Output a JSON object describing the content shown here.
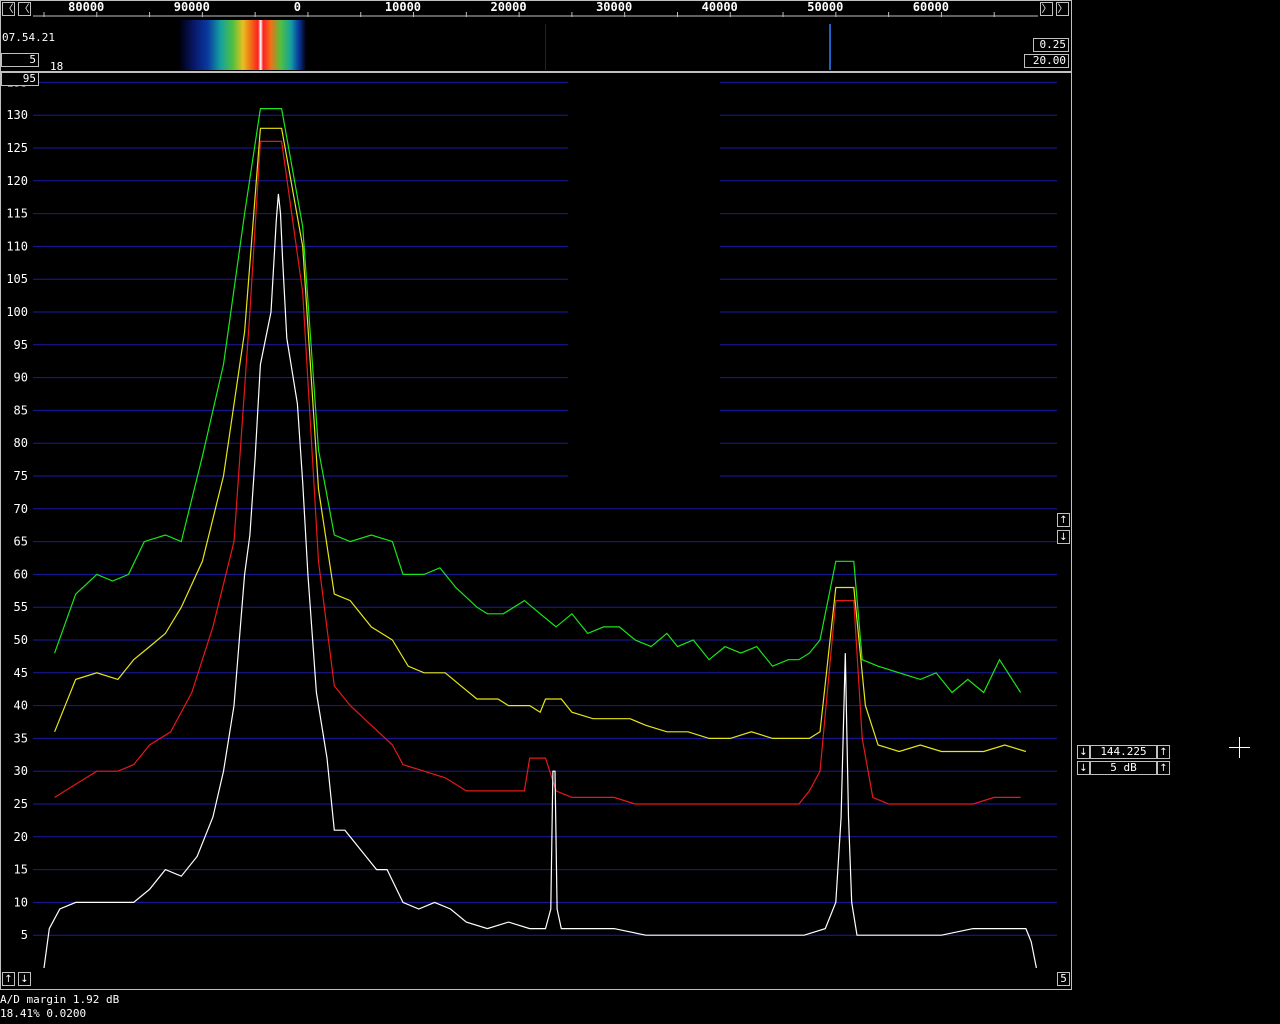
{
  "top_panel": {
    "time": "07.54.21",
    "left_value": "5",
    "left_small": "18",
    "right_value_1": "0.25",
    "right_value_2": "20.00",
    "freq_ticks": [
      {
        "label": "80000",
        "hz": -20000
      },
      {
        "label": "90000",
        "hz": -10000
      },
      {
        "label": "0",
        "hz": 0
      },
      {
        "label": "10000",
        "hz": 10000
      },
      {
        "label": "20000",
        "hz": 20000
      },
      {
        "label": "30000",
        "hz": 30000
      },
      {
        "label": "40000",
        "hz": 40000
      },
      {
        "label": "50000",
        "hz": 50000
      },
      {
        "label": "60000",
        "hz": 60000
      }
    ],
    "scroll_left_icon": "arrow-left-icon",
    "scroll_right_icon": "arrow-right-icon"
  },
  "main": {
    "ref_box": "95",
    "bottom_box": "5"
  },
  "right_panel": {
    "freq_value": "144.225",
    "step_value": "5 dB"
  },
  "status": {
    "line1": "A/D margin  1.92 dB",
    "line2": "18.41% 0.0200"
  },
  "chart_data": {
    "type": "line",
    "x_unit": "Hz offset",
    "xlim": [
      -24000,
      71000
    ],
    "ylim": [
      0,
      138
    ],
    "yticks": [
      5,
      10,
      15,
      20,
      25,
      30,
      35,
      40,
      45,
      50,
      55,
      60,
      65,
      70,
      75,
      80,
      85,
      90,
      95,
      100,
      105,
      110,
      115,
      120,
      125,
      130,
      135
    ],
    "grid": true,
    "colors": {
      "grid": "#1a1aa8",
      "green": "#19e619",
      "yellow": "#e6e619",
      "red": "#e61919",
      "white": "#ffffff"
    },
    "series": [
      {
        "color": "green",
        "points": [
          [
            -23000,
            48
          ],
          [
            -21000,
            57
          ],
          [
            -19000,
            60
          ],
          [
            -17500,
            59
          ],
          [
            -16000,
            60
          ],
          [
            -14500,
            65
          ],
          [
            -12500,
            66
          ],
          [
            -11000,
            65
          ],
          [
            -9000,
            78
          ],
          [
            -7000,
            92
          ],
          [
            -5000,
            115
          ],
          [
            -3500,
            131
          ],
          [
            -1500,
            131
          ],
          [
            500,
            113
          ],
          [
            2000,
            79
          ],
          [
            3500,
            66
          ],
          [
            5000,
            65
          ],
          [
            7000,
            66
          ],
          [
            9000,
            65
          ],
          [
            10000,
            60
          ],
          [
            12000,
            60
          ],
          [
            13500,
            61
          ],
          [
            15000,
            58
          ],
          [
            17000,
            55
          ],
          [
            18000,
            54
          ],
          [
            19500,
            54
          ],
          [
            21500,
            56
          ],
          [
            23000,
            54
          ],
          [
            24500,
            52
          ],
          [
            26000,
            54
          ],
          [
            27500,
            51
          ],
          [
            29000,
            52
          ],
          [
            30500,
            52
          ],
          [
            32000,
            50
          ],
          [
            33500,
            49
          ],
          [
            35000,
            51
          ],
          [
            36000,
            49
          ],
          [
            37500,
            50
          ],
          [
            39000,
            47
          ],
          [
            40500,
            49
          ],
          [
            42000,
            48
          ],
          [
            43500,
            49
          ],
          [
            45000,
            46
          ],
          [
            46500,
            47
          ],
          [
            47500,
            47
          ],
          [
            48500,
            48
          ],
          [
            49500,
            50
          ],
          [
            51000,
            62
          ],
          [
            52700,
            62
          ],
          [
            53500,
            47
          ],
          [
            55000,
            46
          ],
          [
            57000,
            45
          ],
          [
            59000,
            44
          ],
          [
            60500,
            45
          ],
          [
            62000,
            42
          ],
          [
            63500,
            44
          ],
          [
            65000,
            42
          ],
          [
            66500,
            47
          ],
          [
            68500,
            42
          ]
        ]
      },
      {
        "color": "yellow",
        "points": [
          [
            -23000,
            36
          ],
          [
            -21000,
            44
          ],
          [
            -19000,
            45
          ],
          [
            -17000,
            44
          ],
          [
            -15500,
            47
          ],
          [
            -14000,
            49
          ],
          [
            -12500,
            51
          ],
          [
            -11000,
            55
          ],
          [
            -9000,
            62
          ],
          [
            -7000,
            75
          ],
          [
            -5000,
            97
          ],
          [
            -3500,
            128
          ],
          [
            -1500,
            128
          ],
          [
            500,
            110
          ],
          [
            2000,
            73
          ],
          [
            3500,
            57
          ],
          [
            5000,
            56
          ],
          [
            7000,
            52
          ],
          [
            9000,
            50
          ],
          [
            10500,
            46
          ],
          [
            12000,
            45
          ],
          [
            14000,
            45
          ],
          [
            15500,
            43
          ],
          [
            17000,
            41
          ],
          [
            19000,
            41
          ],
          [
            20000,
            40
          ],
          [
            22000,
            40
          ],
          [
            23000,
            39
          ],
          [
            23500,
            41
          ],
          [
            25000,
            41
          ],
          [
            26000,
            39
          ],
          [
            28000,
            38
          ],
          [
            30000,
            38
          ],
          [
            31500,
            38
          ],
          [
            33000,
            37
          ],
          [
            35000,
            36
          ],
          [
            37000,
            36
          ],
          [
            39000,
            35
          ],
          [
            41000,
            35
          ],
          [
            43000,
            36
          ],
          [
            45000,
            35
          ],
          [
            47000,
            35
          ],
          [
            48500,
            35
          ],
          [
            49500,
            36
          ],
          [
            51000,
            58
          ],
          [
            52700,
            58
          ],
          [
            53800,
            40
          ],
          [
            55000,
            34
          ],
          [
            57000,
            33
          ],
          [
            59000,
            34
          ],
          [
            61000,
            33
          ],
          [
            63000,
            33
          ],
          [
            65000,
            33
          ],
          [
            67000,
            34
          ],
          [
            69000,
            33
          ]
        ]
      },
      {
        "color": "red",
        "points": [
          [
            -23000,
            26
          ],
          [
            -21000,
            28
          ],
          [
            -19000,
            30
          ],
          [
            -17000,
            30
          ],
          [
            -15500,
            31
          ],
          [
            -14000,
            34
          ],
          [
            -12000,
            36
          ],
          [
            -10000,
            42
          ],
          [
            -8000,
            52
          ],
          [
            -6000,
            65
          ],
          [
            -4500,
            100
          ],
          [
            -3500,
            126
          ],
          [
            -1500,
            126
          ],
          [
            500,
            103
          ],
          [
            2000,
            62
          ],
          [
            3500,
            43
          ],
          [
            5000,
            40
          ],
          [
            7000,
            37
          ],
          [
            9000,
            34
          ],
          [
            10000,
            31
          ],
          [
            12000,
            30
          ],
          [
            14000,
            29
          ],
          [
            16000,
            27
          ],
          [
            18000,
            27
          ],
          [
            20000,
            27
          ],
          [
            21500,
            27
          ],
          [
            22000,
            32
          ],
          [
            23500,
            32
          ],
          [
            24500,
            27
          ],
          [
            26000,
            26
          ],
          [
            28000,
            26
          ],
          [
            30000,
            26
          ],
          [
            32000,
            25
          ],
          [
            34000,
            25
          ],
          [
            36000,
            25
          ],
          [
            38000,
            25
          ],
          [
            40000,
            25
          ],
          [
            42000,
            25
          ],
          [
            44000,
            25
          ],
          [
            46000,
            25
          ],
          [
            47500,
            25
          ],
          [
            48500,
            27
          ],
          [
            49500,
            30
          ],
          [
            51000,
            56
          ],
          [
            52700,
            56
          ],
          [
            53500,
            35
          ],
          [
            54500,
            26
          ],
          [
            56000,
            25
          ],
          [
            58000,
            25
          ],
          [
            60000,
            25
          ],
          [
            62000,
            25
          ],
          [
            64000,
            25
          ],
          [
            66000,
            26
          ],
          [
            68500,
            26
          ]
        ]
      },
      {
        "color": "white",
        "points": [
          [
            -24000,
            0
          ],
          [
            -23500,
            6
          ],
          [
            -22500,
            9
          ],
          [
            -21000,
            10
          ],
          [
            -19000,
            10
          ],
          [
            -17500,
            10
          ],
          [
            -15500,
            10
          ],
          [
            -14000,
            12
          ],
          [
            -12500,
            15
          ],
          [
            -11000,
            14
          ],
          [
            -9500,
            17
          ],
          [
            -8000,
            23
          ],
          [
            -7000,
            30
          ],
          [
            -6000,
            40
          ],
          [
            -5000,
            60
          ],
          [
            -4500,
            66
          ],
          [
            -4000,
            78
          ],
          [
            -3500,
            92
          ],
          [
            -2500,
            100
          ],
          [
            -2000,
            114
          ],
          [
            -1800,
            118
          ],
          [
            -1600,
            115
          ],
          [
            -1400,
            108
          ],
          [
            -1000,
            96
          ],
          [
            0,
            86
          ],
          [
            500,
            74
          ],
          [
            1000,
            60
          ],
          [
            1800,
            42
          ],
          [
            2800,
            32
          ],
          [
            3500,
            21
          ],
          [
            4500,
            21
          ],
          [
            6000,
            18
          ],
          [
            7500,
            15
          ],
          [
            8500,
            15
          ],
          [
            10000,
            10
          ],
          [
            11500,
            9
          ],
          [
            13000,
            10
          ],
          [
            14500,
            9
          ],
          [
            16000,
            7
          ],
          [
            18000,
            6
          ],
          [
            20000,
            7
          ],
          [
            22000,
            6
          ],
          [
            23500,
            6
          ],
          [
            24000,
            9
          ],
          [
            24200,
            30
          ],
          [
            24400,
            30
          ],
          [
            24600,
            9
          ],
          [
            25000,
            6
          ],
          [
            27000,
            6
          ],
          [
            30000,
            6
          ],
          [
            33000,
            5
          ],
          [
            36000,
            5
          ],
          [
            39000,
            5
          ],
          [
            42000,
            5
          ],
          [
            45000,
            5
          ],
          [
            48000,
            5
          ],
          [
            50000,
            6
          ],
          [
            51000,
            10
          ],
          [
            51500,
            23
          ],
          [
            51900,
            48
          ],
          [
            52200,
            23
          ],
          [
            52500,
            10
          ],
          [
            53000,
            5
          ],
          [
            55000,
            5
          ],
          [
            58000,
            5
          ],
          [
            61000,
            5
          ],
          [
            64000,
            6
          ],
          [
            67000,
            6
          ],
          [
            69000,
            6
          ],
          [
            69500,
            4
          ],
          [
            70000,
            0
          ]
        ]
      }
    ]
  }
}
